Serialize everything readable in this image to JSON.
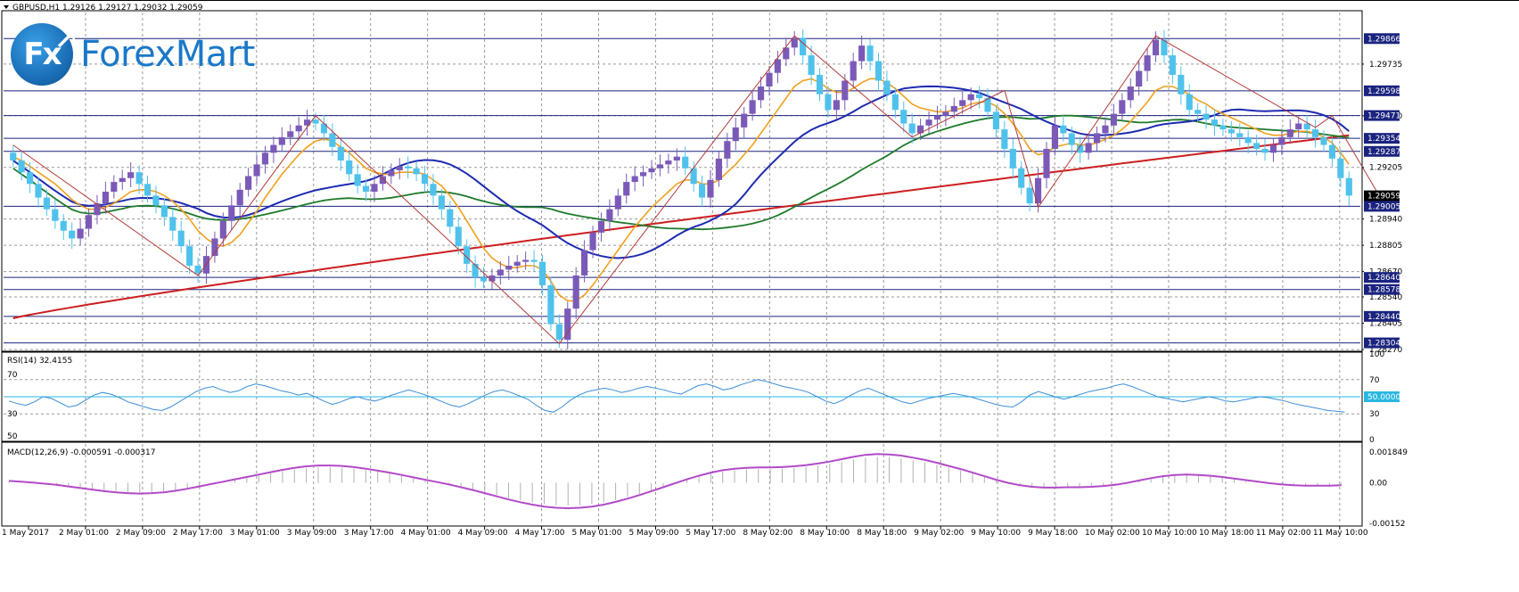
{
  "window": {
    "symbol_caption": "GBPUSD,H1  1.29126 1.29127 1.29032 1.29059"
  },
  "logo": {
    "badge": "Fx",
    "name": "ForexMart"
  },
  "colors": {
    "bull_candle": "#7b5ab7",
    "bear_candle": "#4fc2ec",
    "ma_fast": "#f0a020",
    "ma_mid": "#1e2bb0",
    "ma_slow": "#1e7a2a",
    "ma_long": "#cc1f1f",
    "zigzag": "#b33a3a",
    "rsi_line": "#3c8ed8",
    "rsi_level": "#29b8e0",
    "macd_signal": "#b24ac8",
    "macd_hist": "#b0b0b0",
    "hline": "#1a237e",
    "grid": "#9a9a9a"
  },
  "price_axis": {
    "labels": [
      "1.29735",
      "1.29470",
      "1.29205",
      "1.28940",
      "1.28805",
      "1.28670",
      "1.28540",
      "1.28405",
      "1.28270"
    ],
    "highlighted": [
      {
        "label": "1.29866",
        "style": "dark"
      },
      {
        "label": "1.29598",
        "style": "dark"
      },
      {
        "label": "1.29471",
        "style": "dark"
      },
      {
        "label": "1.29354",
        "style": "dark"
      },
      {
        "label": "1.29287",
        "style": "dark"
      },
      {
        "label": "1.29059",
        "style": "current"
      },
      {
        "label": "1.29005",
        "style": "dark"
      },
      {
        "label": "1.28640",
        "style": "dark"
      },
      {
        "label": "1.28578",
        "style": "dark"
      },
      {
        "label": "1.28440",
        "style": "dark"
      },
      {
        "label": "1.28304",
        "style": "dark"
      }
    ]
  },
  "rsi": {
    "caption": "RSI(14) 32.4155",
    "axis_labels": [
      "100",
      "70",
      "50.0000",
      "30",
      "0"
    ],
    "left_labels": [
      "70",
      "30",
      "50"
    ]
  },
  "macd": {
    "caption": "MACD(12,26,9) -0.000591 -0.000317",
    "axis_labels": [
      "0.001849",
      "0.00",
      "-0.00152"
    ]
  },
  "time_axis": {
    "labels": [
      "1 May 2017",
      "2 May 01:00",
      "2 May 09:00",
      "2 May 17:00",
      "3 May 01:00",
      "3 May 09:00",
      "3 May 17:00",
      "4 May 01:00",
      "4 May 09:00",
      "4 May 17:00",
      "5 May 01:00",
      "5 May 09:00",
      "5 May 17:00",
      "8 May 02:00",
      "8 May 10:00",
      "8 May 18:00",
      "9 May 02:00",
      "9 May 10:00",
      "9 May 18:00",
      "10 May 02:00",
      "10 May 10:00",
      "10 May 18:00",
      "11 May 02:00",
      "11 May 10:00"
    ]
  },
  "chart_data": {
    "type": "candlestick",
    "symbol": "GBPUSD",
    "timeframe": "H1",
    "last": {
      "open": 1.29126,
      "high": 1.29127,
      "low": 1.29032,
      "close": 1.29059
    },
    "price_range": [
      1.2827,
      1.3
    ],
    "closes": [
      1.2924,
      1.2918,
      1.2912,
      1.2905,
      1.2899,
      1.2893,
      1.2888,
      1.2884,
      1.2889,
      1.2896,
      1.2902,
      1.2908,
      1.2913,
      1.2915,
      1.2918,
      1.2912,
      1.2906,
      1.2901,
      1.2895,
      1.2888,
      1.288,
      1.287,
      1.2866,
      1.2875,
      1.2884,
      1.2893,
      1.2901,
      1.2909,
      1.2916,
      1.2922,
      1.2928,
      1.2932,
      1.2936,
      1.2939,
      1.2942,
      1.2945,
      1.2943,
      1.2938,
      1.2931,
      1.2924,
      1.2917,
      1.2911,
      1.2908,
      1.2912,
      1.2916,
      1.2919,
      1.2921,
      1.292,
      1.2917,
      1.2912,
      1.2906,
      1.2899,
      1.289,
      1.288,
      1.2871,
      1.2864,
      1.2862,
      1.2865,
      1.2868,
      1.287,
      1.2872,
      1.2873,
      1.2872,
      1.286,
      1.284,
      1.2832,
      1.2848,
      1.2865,
      1.2878,
      1.2887,
      1.2893,
      1.2899,
      1.2906,
      1.2913,
      1.2916,
      1.2918,
      1.292,
      1.2922,
      1.2924,
      1.2926,
      1.292,
      1.2912,
      1.2905,
      1.2914,
      1.2925,
      1.2934,
      1.2941,
      1.2948,
      1.2955,
      1.2962,
      1.2969,
      1.2976,
      1.2982,
      1.2987,
      1.2978,
      1.2968,
      1.2958,
      1.295,
      1.2955,
      1.2965,
      1.2975,
      1.2983,
      1.2975,
      1.2965,
      1.2958,
      1.295,
      1.2943,
      1.2938,
      1.2942,
      1.2945,
      1.2947,
      1.2949,
      1.2952,
      1.2955,
      1.2958,
      1.2956,
      1.2949,
      1.294,
      1.293,
      1.292,
      1.291,
      1.2902,
      1.2915,
      1.293,
      1.2942,
      1.2938,
      1.2932,
      1.2928,
      1.2933,
      1.2938,
      1.2942,
      1.2948,
      1.2955,
      1.2962,
      1.297,
      1.2978,
      1.2986,
      1.2978,
      1.2968,
      1.2958,
      1.295,
      1.2948,
      1.2945,
      1.2942,
      1.294,
      1.2938,
      1.2936,
      1.2933,
      1.293,
      1.2928,
      1.2932,
      1.2936,
      1.294,
      1.2943,
      1.294,
      1.2936,
      1.2932,
      1.2925,
      1.2915,
      1.2906
    ],
    "hlines": [
      1.29866,
      1.29598,
      1.29471,
      1.29354,
      1.29287,
      1.29005,
      1.2864,
      1.28578,
      1.2844,
      1.28304
    ],
    "zigzag": [
      [
        0,
        1.2932
      ],
      [
        22,
        1.2865
      ],
      [
        36,
        1.2947
      ],
      [
        65,
        1.283
      ],
      [
        93,
        1.2988
      ],
      [
        107,
        1.2936
      ],
      [
        118,
        1.296
      ],
      [
        122,
        1.29
      ],
      [
        136,
        1.2988
      ],
      [
        155,
        1.2941
      ],
      [
        157,
        1.2947
      ],
      [
        163,
        1.2903
      ]
    ],
    "ma_fast": [
      1.2926,
      1.2924,
      1.2921,
      1.2918,
      1.2915,
      1.2912,
      1.2908,
      1.2904,
      1.2901,
      1.2899,
      1.2899,
      1.29,
      1.2902,
      1.2905,
      1.2908,
      1.2909,
      1.2909,
      1.2908,
      1.2906,
      1.2903,
      1.2899,
      1.2894,
      1.2888,
      1.2884,
      1.2881,
      1.288,
      1.2882,
      1.2886,
      1.2892,
      1.2898,
      1.2905,
      1.2911,
      1.2917,
      1.2922,
      1.2927,
      1.2931,
      1.2934,
      1.2935,
      1.2934,
      1.2931,
      1.2928,
      1.2924,
      1.292,
      1.2918,
      1.2917,
      1.2917,
      1.2918,
      1.2918,
      1.2918,
      1.2917,
      1.2914,
      1.2911,
      1.2906,
      1.29,
      1.2893,
      1.2886,
      1.2879,
      1.2874,
      1.2871,
      1.2869,
      1.2869,
      1.287,
      1.287,
      1.2868,
      1.2862,
      1.2855,
      1.2852,
      1.2852,
      1.2855,
      1.286,
      1.2866,
      1.2872,
      1.2878,
      1.2884,
      1.289,
      1.2895,
      1.29,
      1.2904,
      1.2908,
      1.2912,
      1.2914,
      1.2914,
      1.2912,
      1.2912,
      1.2914,
      1.2918,
      1.2922,
      1.2927,
      1.2932,
      1.2938,
      1.2944,
      1.295,
      1.2956,
      1.2962,
      1.2965,
      1.2966,
      1.2964,
      1.2961,
      1.2959,
      1.2959,
      1.2961,
      1.2964,
      1.2966,
      1.2966,
      1.2964,
      1.2961,
      1.2957,
      1.2953,
      1.2951,
      1.295,
      1.2949,
      1.2949,
      1.295,
      1.2951,
      1.2953,
      1.2954,
      1.2954,
      1.2952,
      1.2948,
      1.2943,
      1.2937,
      1.293,
      1.2927,
      1.2928,
      1.2931,
      1.2932,
      1.2933,
      1.2932,
      1.2932,
      1.2933,
      1.2935,
      1.2937,
      1.294,
      1.2944,
      1.2949,
      1.2954,
      1.296,
      1.2962,
      1.2962,
      1.296,
      1.2958,
      1.2955,
      1.2953,
      1.295,
      1.2948,
      1.2946,
      1.2944,
      1.2942,
      1.294,
      1.2938,
      1.2937,
      1.2937,
      1.2938,
      1.2939,
      1.2939,
      1.2938,
      1.2936,
      1.2933,
      1.2928,
      1.2922
    ],
    "rsi_values": [
      45,
      42,
      40,
      44,
      50,
      48,
      43,
      38,
      40,
      46,
      52,
      55,
      53,
      49,
      44,
      41,
      38,
      35,
      34,
      38,
      44,
      50,
      56,
      60,
      62,
      58,
      55,
      57,
      62,
      65,
      63,
      60,
      57,
      55,
      52,
      54,
      50,
      45,
      41,
      44,
      48,
      50,
      47,
      45,
      48,
      52,
      55,
      58,
      55,
      52,
      48,
      44,
      40,
      38,
      42,
      47,
      52,
      56,
      58,
      55,
      51,
      47,
      40,
      34,
      32,
      38,
      46,
      52,
      56,
      58,
      60,
      58,
      55,
      57,
      60,
      62,
      60,
      58,
      55,
      53,
      58,
      63,
      65,
      62,
      58,
      60,
      64,
      67,
      70,
      68,
      65,
      62,
      60,
      58,
      55,
      50,
      45,
      42,
      46,
      52,
      57,
      60,
      56,
      52,
      48,
      44,
      42,
      45,
      48,
      50,
      52,
      54,
      52,
      50,
      47,
      44,
      41,
      39,
      38,
      44,
      52,
      56,
      53,
      50,
      47,
      50,
      53,
      56,
      58,
      60,
      63,
      65,
      62,
      58,
      54,
      50,
      48,
      46,
      44,
      46,
      48,
      50,
      48,
      45,
      44,
      46,
      48,
      50,
      49,
      47,
      45,
      42,
      40,
      38,
      36,
      34,
      33,
      32
    ],
    "macd_values": [
      5e-05,
      3e-05,
      1e-05,
      -2e-05,
      -5e-05,
      -9e-05,
      -0.00013,
      -0.00017,
      -0.00021,
      -0.00024,
      -0.00026,
      -0.00027,
      -0.00026,
      -0.00024,
      -0.0002,
      -0.00015,
      -9e-05,
      -3e-05,
      3e-05,
      9e-05,
      0.00015,
      0.00021,
      0.00027,
      0.00033,
      0.00038,
      0.00042,
      0.00044,
      0.00044,
      0.00043,
      0.0004,
      0.00036,
      0.00031,
      0.00026,
      0.0002,
      0.00014,
      8e-05,
      2e-05,
      -4e-05,
      -0.00011,
      -0.00018,
      -0.00026,
      -0.00034,
      -0.00042,
      -0.00049,
      -0.00055,
      -0.0006,
      -0.00063,
      -0.00064,
      -0.00063,
      -0.0006,
      -0.00055,
      -0.00048,
      -0.0004,
      -0.00031,
      -0.00021,
      -0.00011,
      -1e-05,
      9e-05,
      0.00018,
      0.00026,
      0.00032,
      0.00036,
      0.00038,
      0.00039,
      0.00039,
      0.0004,
      0.00042,
      0.00045,
      0.00049,
      0.00054,
      0.0006,
      0.00066,
      0.00071,
      0.00073,
      0.00072,
      0.00069,
      0.00064,
      0.00058,
      0.00051,
      0.00043,
      0.00035,
      0.00026,
      0.00017,
      8e-05,
      0.0,
      -6e-05,
      -0.0001,
      -0.00012,
      -0.00012,
      -0.00011,
      -0.00011,
      -0.0001,
      -8e-05,
      -5e-05,
      0.0,
      6e-05,
      0.00012,
      0.00017,
      0.0002,
      0.00021,
      0.0002,
      0.00018,
      0.00015,
      0.00011,
      7e-05,
      3e-05,
      -1e-05,
      -4e-05,
      -6e-05,
      -7e-05,
      -7e-05,
      -7e-05,
      -6e-05
    ]
  }
}
